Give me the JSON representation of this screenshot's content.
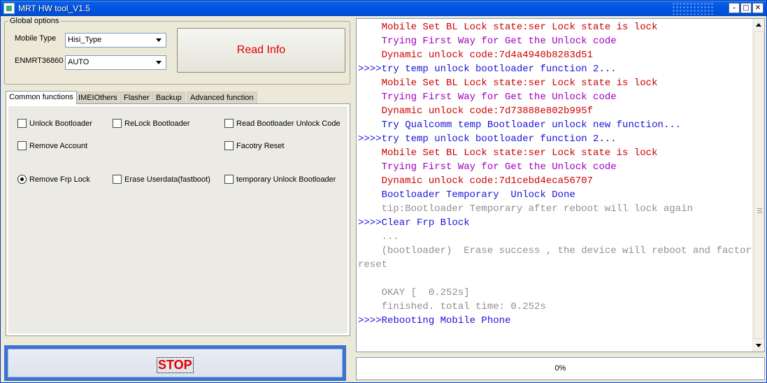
{
  "window": {
    "title": "MRT HW tool_V1.5",
    "controls": {
      "minimize": "–",
      "maximize": "□",
      "close": "✕"
    }
  },
  "global_options": {
    "label": "Global options",
    "mobile_type_label": "Mobile Type",
    "mobile_type_value": "Hisi_Type",
    "enmrt_label": "ENMRT36860",
    "enmrt_value": "AUTO",
    "read_info_label": "Read Info"
  },
  "tabs": [
    {
      "label": "Common functions",
      "active": true
    },
    {
      "label": "IMEIOthers",
      "active": false
    },
    {
      "label": "Flasher",
      "active": false
    },
    {
      "label": "Backup",
      "active": false
    },
    {
      "label": "Advanced function",
      "active": false
    }
  ],
  "functions": {
    "unlock_bootloader": "Unlock Bootloader",
    "relock_bootloader": "ReLock Bootloader",
    "read_bl_unlock_code": "Read Bootloader Unlock Code",
    "remove_account": "Remove Account",
    "factory_reset": "Facotry Reset",
    "remove_frp_lock": "Remove Frp Lock",
    "erase_userdata": "Erase Userdata(fastboot)",
    "temp_unlock_bl": "temporary Unlock Bootloader"
  },
  "stop_label": "STOP",
  "log": [
    {
      "text": "    Mobile Set BL Lock state:ser Lock state is lock",
      "color": "red"
    },
    {
      "text": "    Trying First Way for Get the Unlock code",
      "color": "purple"
    },
    {
      "text": "    Dynamic unlock code:7d4a4940b8283d51",
      "color": "red"
    },
    {
      "text": ">>>>try temp unlock bootloader function 2...",
      "color": "blue"
    },
    {
      "text": "    Mobile Set BL Lock state:ser Lock state is lock",
      "color": "red"
    },
    {
      "text": "    Trying First Way for Get the Unlock code",
      "color": "purple"
    },
    {
      "text": "    Dynamic unlock code:7d73888e802b995f",
      "color": "red"
    },
    {
      "text": "    Try Qualcomm temp Bootloader unlock new function...",
      "color": "blue"
    },
    {
      "text": ">>>>try temp unlock bootloader function 2...",
      "color": "blue"
    },
    {
      "text": "    Mobile Set BL Lock state:ser Lock state is lock",
      "color": "red"
    },
    {
      "text": "    Trying First Way for Get the Unlock code",
      "color": "purple"
    },
    {
      "text": "    Dynamic unlock code:7d1cebd4eca56707",
      "color": "red"
    },
    {
      "text": "    Bootloader Temporary  Unlock Done",
      "color": "blue"
    },
    {
      "text": "    tip:Bootloader Temporary after reboot will lock again",
      "color": "gray"
    },
    {
      "text": ">>>>Clear Frp Block",
      "color": "blue"
    },
    {
      "text": "    ...",
      "color": "gray"
    },
    {
      "text": "    (bootloader)  Erase success , the device will reboot and factory",
      "color": "gray"
    },
    {
      "text": "reset",
      "color": "gray"
    },
    {
      "text": "",
      "color": "gray"
    },
    {
      "text": "    OKAY [  0.252s]",
      "color": "gray"
    },
    {
      "text": "    finished. total time: 0.252s",
      "color": "gray"
    },
    {
      "text": ">>>>Rebooting Mobile Phone",
      "color": "blue"
    }
  ],
  "progress": {
    "text": "0%",
    "value": 0
  },
  "colors": {
    "red": "#d00000",
    "purple": "#a000c0",
    "blue": "#1c14d8",
    "gray": "#909090"
  }
}
